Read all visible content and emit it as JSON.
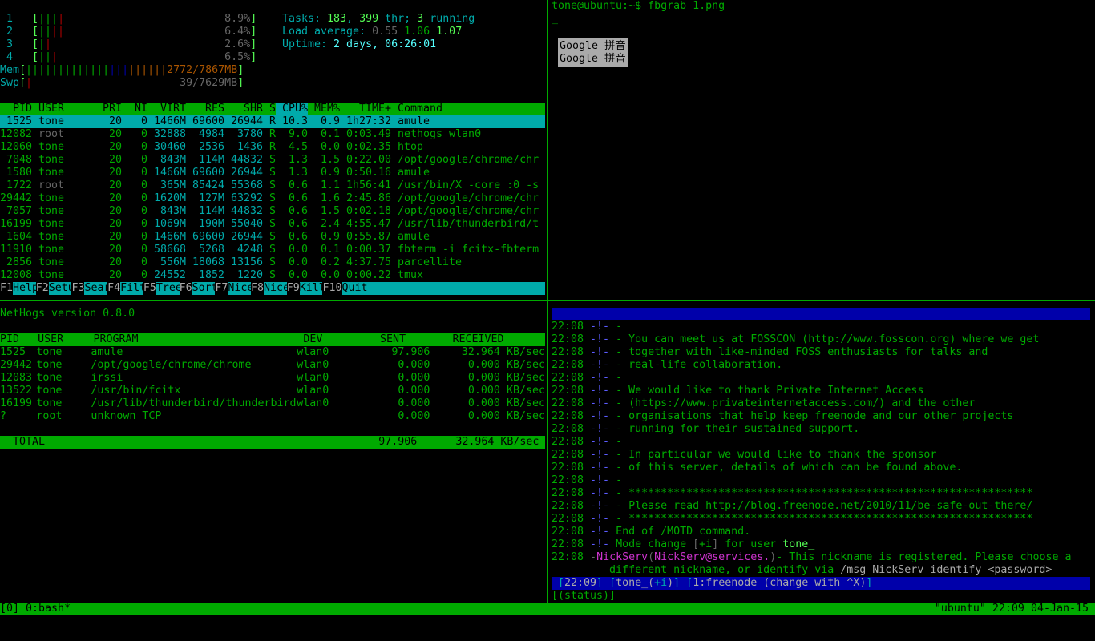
{
  "colors": {
    "terminal_green": "#00aa00",
    "cyan": "#00aaaa",
    "irssi_bar": "#0000aa",
    "popup": "#aaaaaa"
  },
  "htop": {
    "cpus": [
      {
        "label": "1",
        "bars": [
          [
            "g",
            3
          ],
          [
            "rd",
            1
          ]
        ],
        "value": "8.9%"
      },
      {
        "label": "2",
        "bars": [
          [
            "g",
            2
          ],
          [
            "rd",
            2
          ]
        ],
        "value": "6.4%"
      },
      {
        "label": "3",
        "bars": [
          [
            "g",
            1
          ],
          [
            "rd",
            1
          ]
        ],
        "value": "2.6%"
      },
      {
        "label": "4",
        "bars": [
          [
            "g",
            2
          ],
          [
            "rd",
            1
          ]
        ],
        "value": "6.5%"
      }
    ],
    "mem": {
      "label": "Mem",
      "bars": [
        [
          "g",
          13
        ],
        [
          "bl",
          3
        ],
        [
          "or",
          6
        ]
      ],
      "value": "2772/7867MB"
    },
    "swp": {
      "label": "Swp",
      "bars": [
        [
          "rd",
          1
        ]
      ],
      "value": "39/7629MB"
    },
    "tasks_label": "Tasks: ",
    "tasks": "183",
    "threads": "399",
    "thr_label": " thr; ",
    "running": "3",
    "running_label": " running",
    "load_label": "Load average: ",
    "load1": "0.55",
    "load5": "1.06",
    "load15": "1.07",
    "uptime_label": "Uptime: ",
    "uptime": "2 days, 06:26:01",
    "columns": [
      "PID",
      "USER",
      "PRI",
      "NI",
      "VIRT",
      "RES",
      "SHR",
      "S",
      "CPU%",
      "MEM%",
      "TIME+",
      "Command"
    ],
    "sort_column": "CPU%",
    "processes": [
      [
        "1525",
        "tone",
        "20",
        "0",
        "1466M",
        "69600",
        "26944",
        "R",
        "10.3",
        "0.9",
        "1h27:32",
        "amule"
      ],
      [
        "12082",
        "root",
        "20",
        "0",
        "32888",
        "4984",
        "3780",
        "R",
        "9.0",
        "0.1",
        "0:03.49",
        "nethogs wlan0"
      ],
      [
        "12060",
        "tone",
        "20",
        "0",
        "30460",
        "2536",
        "1436",
        "R",
        "4.5",
        "0.0",
        "0:02.35",
        "htop"
      ],
      [
        "7048",
        "tone",
        "20",
        "0",
        "843M",
        "114M",
        "44832",
        "S",
        "1.3",
        "1.5",
        "0:22.00",
        "/opt/google/chrome/chr"
      ],
      [
        "1580",
        "tone",
        "20",
        "0",
        "1466M",
        "69600",
        "26944",
        "S",
        "1.3",
        "0.9",
        "0:50.16",
        "amule"
      ],
      [
        "1722",
        "root",
        "20",
        "0",
        "365M",
        "85424",
        "55368",
        "S",
        "0.6",
        "1.1",
        "1h56:41",
        "/usr/bin/X -core :0 -s"
      ],
      [
        "29442",
        "tone",
        "20",
        "0",
        "1620M",
        "127M",
        "63292",
        "S",
        "0.6",
        "1.6",
        "2:45.86",
        "/opt/google/chrome/chr"
      ],
      [
        "7057",
        "tone",
        "20",
        "0",
        "843M",
        "114M",
        "44832",
        "S",
        "0.6",
        "1.5",
        "0:02.18",
        "/opt/google/chrome/chr"
      ],
      [
        "16199",
        "tone",
        "20",
        "0",
        "1069M",
        "190M",
        "55040",
        "S",
        "0.6",
        "2.4",
        "4:55.47",
        "/usr/lib/thunderbird/t"
      ],
      [
        "1604",
        "tone",
        "20",
        "0",
        "1466M",
        "69600",
        "26944",
        "S",
        "0.6",
        "0.9",
        "0:55.87",
        "amule"
      ],
      [
        "11910",
        "tone",
        "20",
        "0",
        "58668",
        "5268",
        "4248",
        "S",
        "0.0",
        "0.1",
        "0:00.37",
        "fbterm -i fcitx-fbterm"
      ],
      [
        "2856",
        "tone",
        "20",
        "0",
        "556M",
        "18068",
        "13156",
        "S",
        "0.0",
        "0.2",
        "4:37.75",
        "parcellite"
      ],
      [
        "12008",
        "tone",
        "20",
        "0",
        "24552",
        "1852",
        "1220",
        "S",
        "0.0",
        "0.0",
        "0:00.22",
        "tmux"
      ]
    ],
    "selected_index": 0,
    "fkeys": [
      {
        "key": "F1",
        "label": "Help"
      },
      {
        "key": "F2",
        "label": "Setup"
      },
      {
        "key": "F3",
        "label": "Search"
      },
      {
        "key": "F4",
        "label": "Filter"
      },
      {
        "key": "F5",
        "label": "Tree"
      },
      {
        "key": "F6",
        "label": "SortBy"
      },
      {
        "key": "F7",
        "label": "Nice -"
      },
      {
        "key": "F8",
        "label": "Nice +"
      },
      {
        "key": "F9",
        "label": "Kill"
      },
      {
        "key": "F10",
        "label": "Quit"
      }
    ]
  },
  "nethogs": {
    "title": "NetHogs version 0.8.0",
    "columns": [
      "PID",
      "USER",
      "PROGRAM",
      "DEV",
      "SENT",
      "RECEIVED"
    ],
    "rows": [
      [
        "1525",
        "tone",
        "amule",
        "wlan0",
        "97.906",
        "32.964 KB/sec"
      ],
      [
        "29442",
        "tone",
        "/opt/google/chrome/chrome",
        "wlan0",
        "0.000",
        "0.000 KB/sec"
      ],
      [
        "12083",
        "tone",
        "irssi",
        "wlan0",
        "0.000",
        "0.000 KB/sec"
      ],
      [
        "13522",
        "tone",
        "/usr/bin/fcitx",
        "wlan0",
        "0.000",
        "0.000 KB/sec"
      ],
      [
        "16199",
        "tone",
        "/usr/lib/thunderbird/thunderbird",
        "wlan0",
        "0.000",
        "0.000 KB/sec"
      ],
      [
        "?",
        "root",
        "unknown TCP",
        "",
        "0.000",
        "0.000 KB/sec"
      ]
    ],
    "total_label": "TOTAL",
    "total_sent": "97.906",
    "total_received": "32.964 KB/sec"
  },
  "shell": {
    "prompt": "tone@ubuntu:~$ fbgrab 1.png",
    "cursor": "_",
    "ime_candidates": [
      "Google 拼音",
      "Google 拼音"
    ]
  },
  "irssi": {
    "lines": [
      [
        [
          "22:08 ",
          "g"
        ],
        [
          "-!-",
          "lb"
        ],
        [
          " -",
          "g"
        ]
      ],
      [
        [
          "22:08 ",
          "g"
        ],
        [
          "-!-",
          "lb"
        ],
        [
          " - You can meet us at FOSSCON (http://www.fosscon.org) where we get",
          "g"
        ]
      ],
      [
        [
          "22:08 ",
          "g"
        ],
        [
          "-!-",
          "lb"
        ],
        [
          " - together with like-minded FOSS enthusiasts for talks and",
          "g"
        ]
      ],
      [
        [
          "22:08 ",
          "g"
        ],
        [
          "-!-",
          "lb"
        ],
        [
          " - real-life collaboration.",
          "g"
        ]
      ],
      [
        [
          "22:08 ",
          "g"
        ],
        [
          "-!-",
          "lb"
        ],
        [
          " -",
          "g"
        ]
      ],
      [
        [
          "22:08 ",
          "g"
        ],
        [
          "-!-",
          "lb"
        ],
        [
          " - We would like to thank Private Internet Access",
          "g"
        ]
      ],
      [
        [
          "22:08 ",
          "g"
        ],
        [
          "-!-",
          "lb"
        ],
        [
          " - (https://www.privateinternetaccess.com/) and the other",
          "g"
        ]
      ],
      [
        [
          "22:08 ",
          "g"
        ],
        [
          "-!-",
          "lb"
        ],
        [
          " - organisations that help keep freenode and our other projects",
          "g"
        ]
      ],
      [
        [
          "22:08 ",
          "g"
        ],
        [
          "-!-",
          "lb"
        ],
        [
          " - running for their sustained support.",
          "g"
        ]
      ],
      [
        [
          "22:08 ",
          "g"
        ],
        [
          "-!-",
          "lb"
        ],
        [
          " -",
          "g"
        ]
      ],
      [
        [
          "22:08 ",
          "g"
        ],
        [
          "-!-",
          "lb"
        ],
        [
          " - In particular we would like to thank the sponsor",
          "g"
        ]
      ],
      [
        [
          "22:08 ",
          "g"
        ],
        [
          "-!-",
          "lb"
        ],
        [
          " - of this server, details of which can be found above.",
          "g"
        ]
      ],
      [
        [
          "22:08 ",
          "g"
        ],
        [
          "-!-",
          "lb"
        ],
        [
          " -",
          "g"
        ]
      ],
      [
        [
          "22:08 ",
          "g"
        ],
        [
          "-!-",
          "lb"
        ],
        [
          " - ***************************************************************",
          "g"
        ]
      ],
      [
        [
          "22:08 ",
          "g"
        ],
        [
          "-!-",
          "lb"
        ],
        [
          " - Please read http://blog.freenode.net/2010/11/be-safe-out-there/",
          "g"
        ]
      ],
      [
        [
          "22:08 ",
          "g"
        ],
        [
          "-!-",
          "lb"
        ],
        [
          " - ***************************************************************",
          "g"
        ]
      ],
      [
        [
          "22:08 ",
          "g"
        ],
        [
          "-!-",
          "lb"
        ],
        [
          " End of /MOTD command.",
          "g"
        ]
      ],
      [
        [
          "22:08 ",
          "g"
        ],
        [
          "-!-",
          "lb"
        ],
        [
          " Mode change ",
          "g"
        ],
        [
          "[",
          "gr"
        ],
        [
          "+i",
          "g"
        ],
        [
          "]",
          "gr"
        ],
        [
          " for user ",
          "g"
        ],
        [
          "tone_",
          "bg"
        ]
      ],
      [
        [
          "22:08 ",
          "g"
        ],
        [
          "-",
          "gr"
        ],
        [
          "NickServ",
          "mg"
        ],
        [
          "(",
          "gr"
        ],
        [
          "NickServ@services.",
          "mg"
        ],
        [
          ")",
          "gr"
        ],
        [
          "- This nickname is registered. Please choose a",
          "g"
        ]
      ],
      [
        [
          "         different nickname, or identify via ",
          "g"
        ],
        [
          "/msg NickServ identify <password>",
          "wh"
        ]
      ]
    ],
    "statusbar": [
      [
        " [",
        "cy"
      ],
      [
        "22:09",
        "wh"
      ],
      [
        "] [",
        "cy"
      ],
      [
        "tone_(",
        "wh"
      ],
      [
        "+i",
        "cy"
      ],
      [
        ")",
        "wh"
      ],
      [
        "] [",
        "cy"
      ],
      [
        "1:freenode (change with ^X)",
        "wh"
      ],
      [
        "]",
        "cy"
      ]
    ],
    "input_prompt": "[(status)]"
  },
  "tmux": {
    "window": "[0] 0:bash*",
    "right": "\"ubuntu\" 22:09 04-Jan-15"
  }
}
